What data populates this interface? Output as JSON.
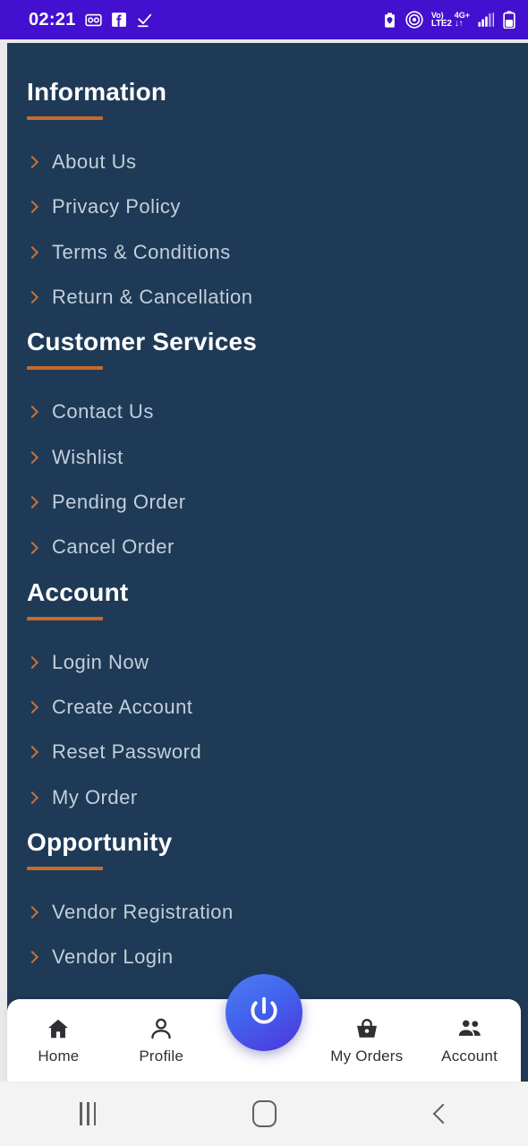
{
  "statusbar": {
    "time": "02:21",
    "left_icons": [
      "voicemail-icon",
      "facebook-icon",
      "download-check-icon"
    ],
    "network_line1": "Vo)",
    "network_line2": "LTE2",
    "data_line1": "4G+",
    "data_line2": "↓↑",
    "right_icons": [
      "battery-saver-icon",
      "hotspot-icon",
      "signal-bars-icon",
      "battery-icon"
    ],
    "background_color": "#4310cf"
  },
  "theme": {
    "page_background": "#1e3a56",
    "accent_orange": "#c76a2b",
    "chevron_orange": "#c9713a",
    "heading_color": "#ffffff",
    "item_color": "#c3cfdb",
    "fab_gradient_start": "#4e7df0",
    "fab_gradient_end": "#5133dd"
  },
  "sections": [
    {
      "title": "Information",
      "items": [
        {
          "label": "About Us"
        },
        {
          "label": "Privacy Policy"
        },
        {
          "label": "Terms & Conditions"
        },
        {
          "label": "Return & Cancellation"
        }
      ]
    },
    {
      "title": "Customer Services",
      "items": [
        {
          "label": "Contact Us"
        },
        {
          "label": "Wishlist"
        },
        {
          "label": "Pending Order"
        },
        {
          "label": "Cancel Order"
        }
      ]
    },
    {
      "title": "Account",
      "items": [
        {
          "label": "Login Now"
        },
        {
          "label": "Create Account"
        },
        {
          "label": "Reset Password"
        },
        {
          "label": "My Order"
        }
      ]
    },
    {
      "title": "Opportunity",
      "items": [
        {
          "label": "Vendor Registration"
        },
        {
          "label": "Vendor Login"
        }
      ]
    }
  ],
  "bottom_nav": {
    "items": [
      {
        "label": "Home",
        "icon": "home-icon"
      },
      {
        "label": "Profile",
        "icon": "person-icon"
      },
      {
        "label": "My Orders",
        "icon": "basket-icon"
      },
      {
        "label": "Account",
        "icon": "group-icon"
      }
    ],
    "fab_icon": "power-icon"
  },
  "system_nav": {
    "recents": "recents-icon",
    "home": "home-square-icon",
    "back": "back-icon"
  }
}
